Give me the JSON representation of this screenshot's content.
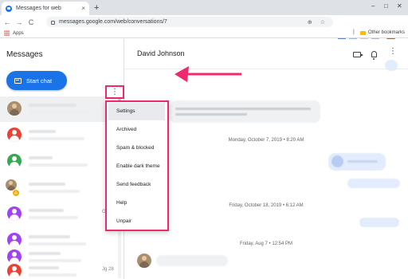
{
  "browser": {
    "tab_title": "Messages for web",
    "tab_close": "×",
    "new_tab": "+",
    "window_controls": [
      "–",
      "□",
      "✕"
    ],
    "nav": [
      "←",
      "→",
      "C"
    ],
    "url": "messages.google.com/web/conversations/7",
    "omnibox_icons": "⊕ ☆",
    "menu": "⋮"
  },
  "bookmarks": {
    "apps_label": "Apps",
    "other_label": "Other bookmarks",
    "separator": "|"
  },
  "sidebar": {
    "title": "Messages",
    "start_chat_label": "Start chat",
    "conversations": [
      {
        "kind": "photo",
        "date": ""
      },
      {
        "kind": "red",
        "date": ""
      },
      {
        "kind": "green",
        "date": ""
      },
      {
        "kind": "photo-badge",
        "badge": "A",
        "date": ""
      },
      {
        "kind": "purple",
        "date": "Oct 5"
      },
      {
        "kind": "purple",
        "date": ""
      },
      {
        "kind": "purple",
        "date": ""
      },
      {
        "kind": "red",
        "date": "Jg 28"
      }
    ]
  },
  "conversation": {
    "contact_name": "David Johnson",
    "date_labels": [
      "Monday, October 7, 2019 • 8:20 AM",
      "Friday, October 18, 2019 • 6:12 AM",
      "Friday, Aug 7 • 12:54 PM"
    ]
  },
  "overflow_menu": {
    "button_glyph": "⋮",
    "items": [
      "Settings",
      "Archived",
      "Spam & blocked",
      "Enable dark theme",
      "Send feedback",
      "Help",
      "Unpair"
    ],
    "highlighted_index": 0
  },
  "colors": {
    "accent": "#1a73e8",
    "annotation": "#f0286e",
    "avatar_red": "#ea4335",
    "avatar_green": "#34a853",
    "avatar_purple": "#a142f4"
  }
}
